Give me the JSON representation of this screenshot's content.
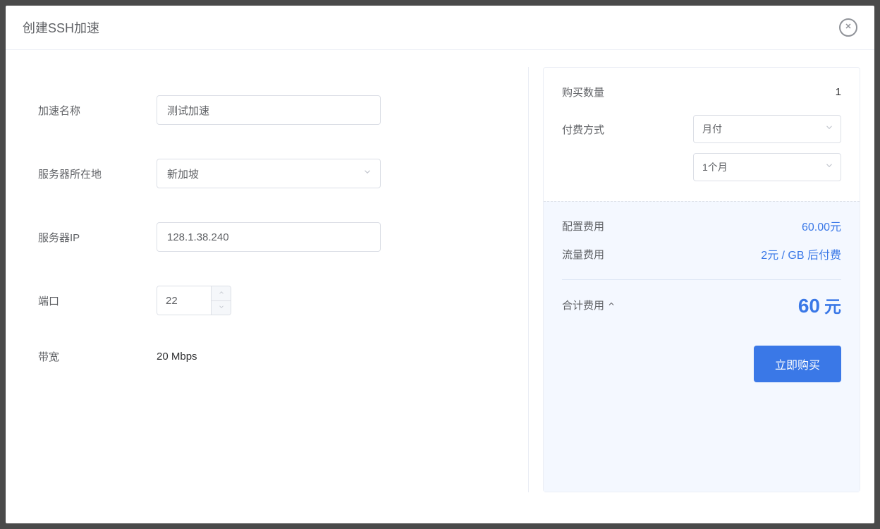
{
  "modal": {
    "title": "创建SSH加速"
  },
  "form": {
    "name_label": "加速名称",
    "name_value": "测试加速",
    "location_label": "服务器所在地",
    "location_value": "新加坡",
    "ip_label": "服务器IP",
    "ip_value": "128.1.38.240",
    "port_label": "端口",
    "port_value": "22",
    "bandwidth_label": "带宽",
    "bandwidth_value": "20 Mbps"
  },
  "summary": {
    "qty_label": "购买数量",
    "qty_value": "1",
    "payment_label": "付费方式",
    "payment_type_value": "月付",
    "duration_value": "1个月",
    "config_cost_label": "配置费用",
    "config_cost_value": "60.00元",
    "traffic_cost_label": "流量费用",
    "traffic_cost_value": "2元 / GB 后付费",
    "total_label": "合计费用",
    "total_value": "60",
    "total_unit": "元",
    "buy_button": "立即购买"
  }
}
